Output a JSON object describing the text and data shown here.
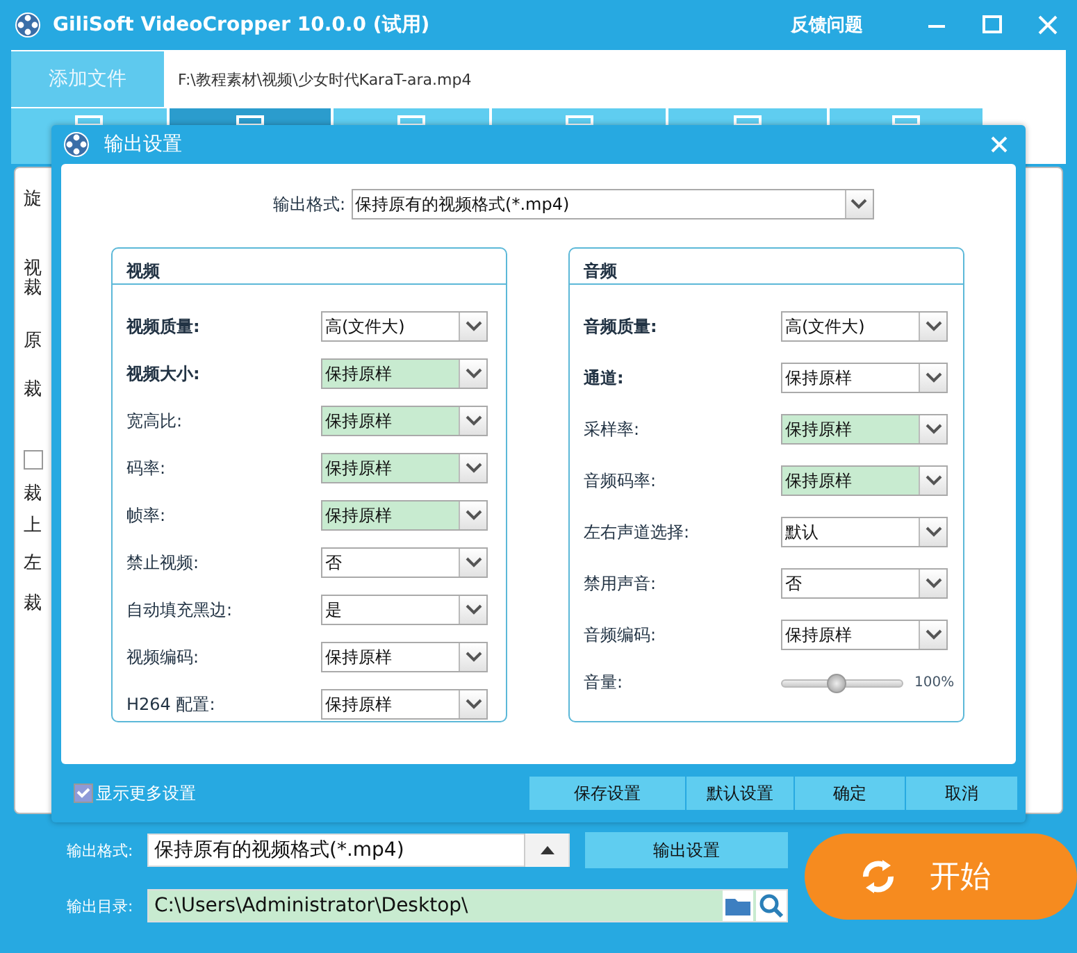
{
  "window": {
    "title": "GiliSoft VideoCropper 10.0.0 (试用)",
    "feedback": "反馈问题"
  },
  "top_bar": {
    "add_file": "添加文件",
    "file_path": "F:\\教程素材\\视频\\少女时代KaraT-ara.mp4"
  },
  "toolbar_tabs": [
    {
      "selected": false
    },
    {
      "selected": true
    },
    {
      "selected": false
    },
    {
      "selected": false
    },
    {
      "selected": false
    },
    {
      "selected": false
    }
  ],
  "background_panel": {
    "items": [
      {
        "kind": "text",
        "text": "旋"
      },
      {
        "kind": "text",
        "text": "视"
      },
      {
        "kind": "text",
        "text": "裁"
      },
      {
        "kind": "text",
        "text": "原"
      },
      {
        "kind": "text",
        "text": "裁"
      },
      {
        "kind": "checkbox",
        "checked": false
      },
      {
        "kind": "text",
        "text": "裁"
      },
      {
        "kind": "text",
        "text": "上"
      },
      {
        "kind": "text",
        "text": "左"
      },
      {
        "kind": "text",
        "text": "裁"
      }
    ]
  },
  "dialog": {
    "title": "输出设置",
    "format_label": "输出格式:",
    "format_value": "保持原有的视频格式(*.mp4)",
    "groups": [
      {
        "title": "视频",
        "kind": "video",
        "rows": [
          {
            "kind": "select",
            "label": "视频质量:",
            "emphasized": true,
            "value": "高(文件大)",
            "highlighted": false
          },
          {
            "kind": "select",
            "label": "视频大小:",
            "emphasized": true,
            "value": "保持原样",
            "highlighted": true
          },
          {
            "kind": "select",
            "label": "宽高比:",
            "emphasized": false,
            "value": "保持原样",
            "highlighted": true
          },
          {
            "kind": "select",
            "label": "码率:",
            "emphasized": false,
            "value": "保持原样",
            "highlighted": true
          },
          {
            "kind": "select",
            "label": "帧率:",
            "emphasized": false,
            "value": "保持原样",
            "highlighted": true
          },
          {
            "kind": "select",
            "label": "禁止视频:",
            "emphasized": false,
            "value": "否",
            "highlighted": false
          },
          {
            "kind": "select",
            "label": "自动填充黑边:",
            "emphasized": false,
            "value": "是",
            "highlighted": false
          },
          {
            "kind": "select",
            "label": "视频编码:",
            "emphasized": false,
            "value": "保持原样",
            "highlighted": false
          },
          {
            "kind": "select",
            "label": "H264 配置:",
            "emphasized": false,
            "value": "保持原样",
            "highlighted": false
          }
        ]
      },
      {
        "title": "音频",
        "kind": "audio",
        "rows": [
          {
            "kind": "select",
            "label": "音频质量:",
            "emphasized": true,
            "value": "高(文件大)",
            "highlighted": false
          },
          {
            "kind": "select",
            "label": "通道:",
            "emphasized": true,
            "value": "保持原样",
            "highlighted": false
          },
          {
            "kind": "select",
            "label": "采样率:",
            "emphasized": false,
            "value": "保持原样",
            "highlighted": true
          },
          {
            "kind": "select",
            "label": "音频码率:",
            "emphasized": false,
            "value": "保持原样",
            "highlighted": true
          },
          {
            "kind": "select",
            "label": "左右声道选择:",
            "emphasized": false,
            "value": "默认",
            "highlighted": false
          },
          {
            "kind": "select",
            "label": "禁用声音:",
            "emphasized": false,
            "value": "否",
            "highlighted": false
          },
          {
            "kind": "select",
            "label": "音频编码:",
            "emphasized": false,
            "value": "保持原样",
            "highlighted": false
          },
          {
            "kind": "slider",
            "label": "音量:",
            "emphasized": false,
            "level": 0.45,
            "reading": "100%"
          }
        ]
      }
    ],
    "more_settings": {
      "label": "显示更多设置",
      "checked": true
    },
    "buttons": [
      "保存设置",
      "默认设置",
      "确定",
      "取消"
    ]
  },
  "bottom": {
    "format_label": "输出格式:",
    "format_value": "保持原有的视频格式(*.mp4)",
    "settings_button": "输出设置",
    "dir_label": "输出目录:",
    "dir_value": "C:\\Users\\Administrator\\Desktop\\",
    "start_button": "开始"
  }
}
